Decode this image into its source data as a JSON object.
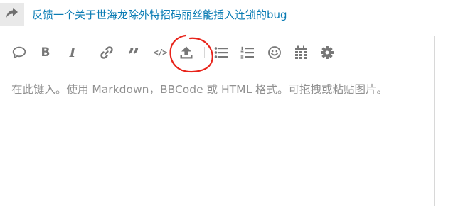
{
  "topic": {
    "reply_icon": "share-reply-icon",
    "title": "反馈一个关于世海龙除外特招码丽丝能插入连锁的bug",
    "color": "#0a7cb4"
  },
  "toolbar": {
    "buttons": [
      {
        "name": "emoji-bubble",
        "icon": "speech-bubble-icon"
      },
      {
        "name": "bold",
        "glyph": "B"
      },
      {
        "name": "italic",
        "glyph": "I"
      },
      {
        "name": "link",
        "icon": "link-icon"
      },
      {
        "name": "quote",
        "glyph": "”"
      },
      {
        "name": "code",
        "glyph": "</>"
      },
      {
        "name": "upload",
        "icon": "upload-icon"
      },
      {
        "name": "bullet-list",
        "icon": "bullet-list-icon"
      },
      {
        "name": "numbered-list",
        "icon": "numbered-list-icon"
      },
      {
        "name": "emoji",
        "icon": "smiley-icon"
      },
      {
        "name": "date",
        "icon": "calendar-icon"
      },
      {
        "name": "options",
        "icon": "gear-icon"
      }
    ],
    "highlight_color": "#e8241b"
  },
  "composer": {
    "placeholder": "在此键入。使用 Markdown，BBCode 或 HTML 格式。可拖拽或粘贴图片。"
  }
}
